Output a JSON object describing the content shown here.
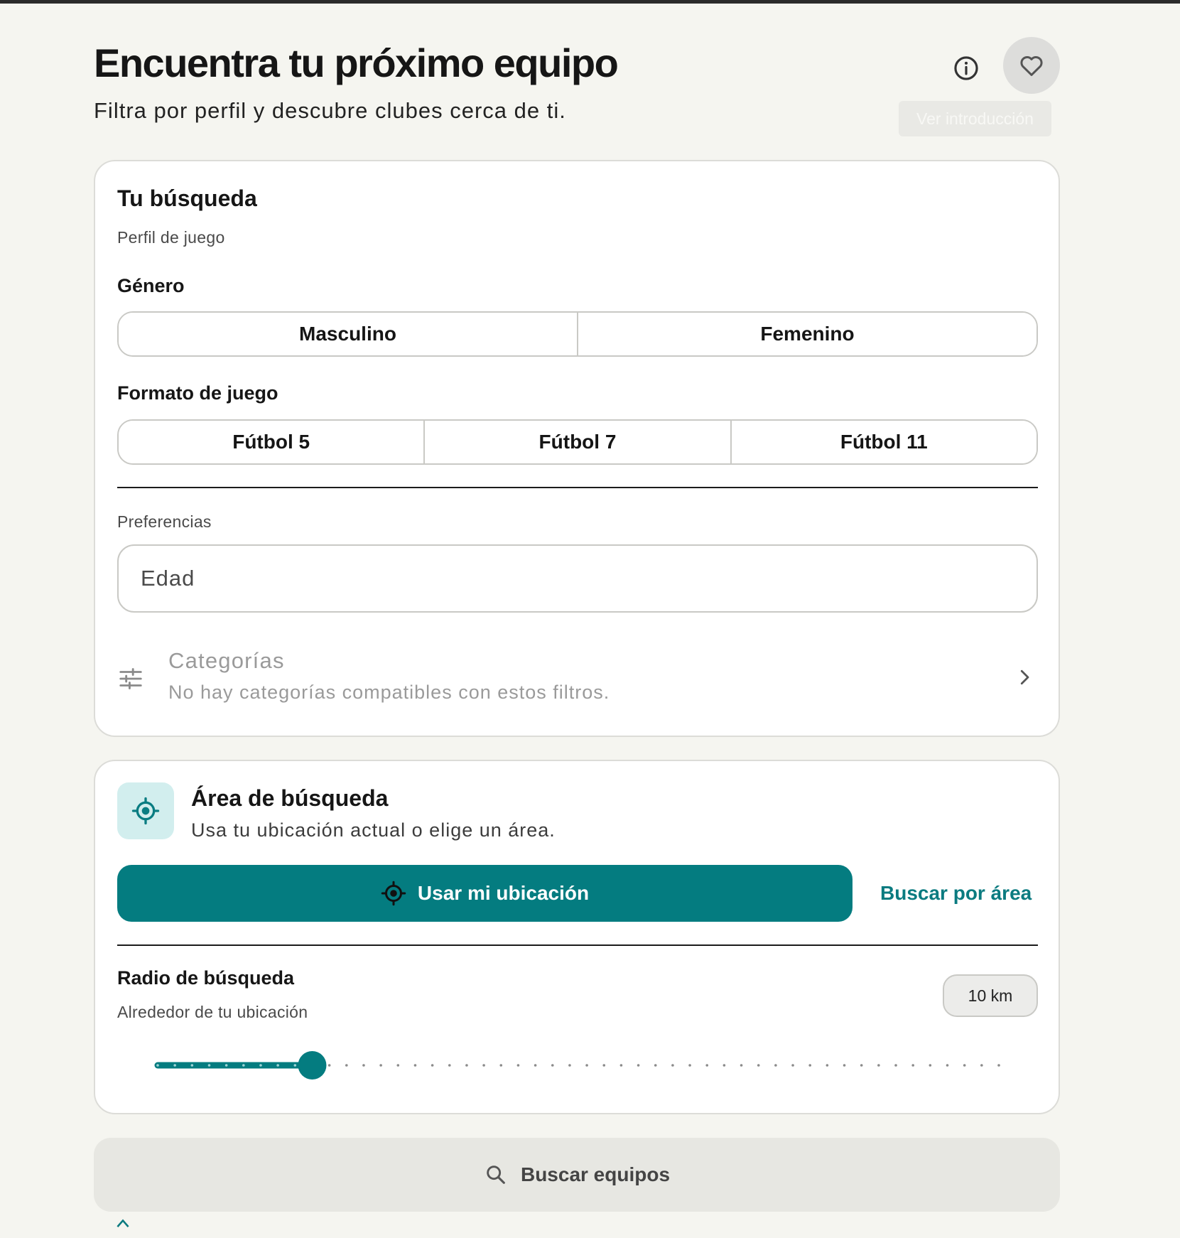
{
  "header": {
    "title": "Encuentra tu próximo equipo",
    "subtitle": "Filtra por perfil y descubre clubes cerca de ti.",
    "intro_label": "Ver introducción",
    "info_icon": "info-icon",
    "favorite_icon": "heart-icon"
  },
  "search_card": {
    "title": "Tu búsqueda",
    "profile_label": "Perfil de juego",
    "gender": {
      "label": "Género",
      "options": [
        "Masculino",
        "Femenino"
      ]
    },
    "format": {
      "label": "Formato de juego",
      "options": [
        "Fútbol 5",
        "Fútbol 7",
        "Fútbol 11"
      ]
    },
    "preferences_label": "Preferencias",
    "age": {
      "placeholder": "Edad",
      "value": ""
    },
    "categories": {
      "title": "Categorías",
      "subtitle": "No hay categorías compatibles con estos filtros.",
      "icon": "tune-icon",
      "chevron": "chevron-right-icon"
    }
  },
  "area_card": {
    "icon": "location-target-icon",
    "title": "Área de búsqueda",
    "subtitle": "Usa tu ubicación actual o elige un área.",
    "use_location_label": "Usar mi ubicación",
    "search_by_area_label": "Buscar por área",
    "radius": {
      "title": "Radio de búsqueda",
      "subtitle": "Alrededor de tu ubicación",
      "value_label": "10 km",
      "value_km": 10,
      "min_km": 1,
      "max_km": 50,
      "step_km": 1
    }
  },
  "search_button": {
    "label": "Buscar equipos",
    "icon": "search-icon"
  },
  "colors": {
    "accent": "#047c80",
    "accent_text": "#0b7b80",
    "background": "#f5f5f0",
    "icon_bg": "#d2eeee"
  }
}
